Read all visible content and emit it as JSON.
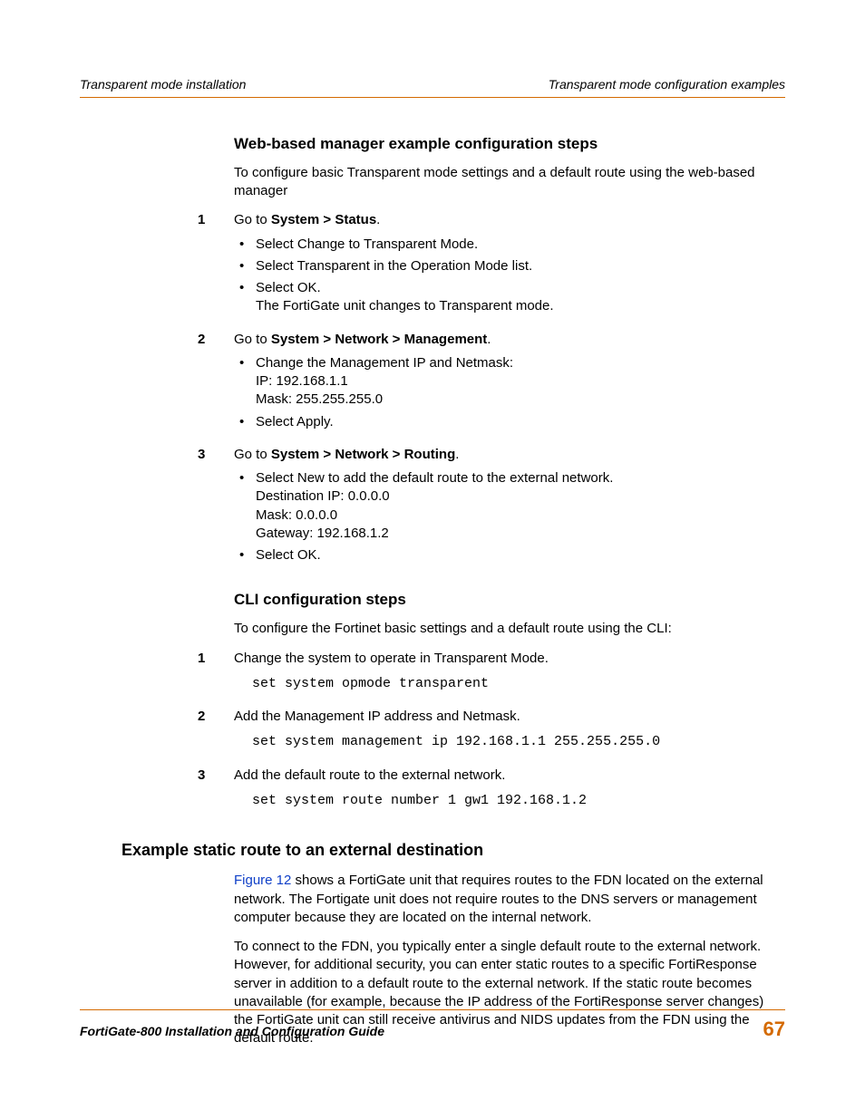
{
  "header": {
    "left": "Transparent mode installation",
    "right": "Transparent mode configuration examples"
  },
  "section1": {
    "heading": "Web-based manager example configuration steps",
    "intro": "To configure basic Transparent mode settings and a default route using the web-based manager",
    "steps": {
      "s1": {
        "num": "1",
        "lead": "Go to ",
        "bold": "System > Status",
        "tail": ".",
        "b1": "Select Change to Transparent Mode.",
        "b2": "Select Transparent in the Operation Mode list.",
        "b3a": "Select OK.",
        "b3b": "The FortiGate unit changes to Transparent mode."
      },
      "s2": {
        "num": "2",
        "lead": "Go to ",
        "bold": "System > Network > Management",
        "tail": ".",
        "b1a": "Change the Management IP and Netmask:",
        "b1b": "IP: 192.168.1.1",
        "b1c": "Mask: 255.255.255.0",
        "b2": "Select Apply."
      },
      "s3": {
        "num": "3",
        "lead": "Go to ",
        "bold": "System > Network > Routing",
        "tail": ".",
        "b1a": "Select New to add the default route to the external network.",
        "b1b": "Destination IP: 0.0.0.0",
        "b1c": "Mask: 0.0.0.0",
        "b1d": "Gateway: 192.168.1.2",
        "b2": "Select OK."
      }
    }
  },
  "section2": {
    "heading": "CLI configuration steps",
    "intro": "To configure the Fortinet basic settings and a default route using the CLI:",
    "steps": {
      "s1": {
        "num": "1",
        "text": "Change the system to operate in Transparent Mode.",
        "code": "set system opmode transparent"
      },
      "s2": {
        "num": "2",
        "text": "Add the Management IP address and Netmask.",
        "code": "set system management ip 192.168.1.1 255.255.255.0"
      },
      "s3": {
        "num": "3",
        "text": "Add the default route to the external network.",
        "code": "set system route number 1 gw1 192.168.1.2"
      }
    }
  },
  "section3": {
    "heading": "Example static route to an external destination",
    "p1_ref": "Figure 12",
    "p1_rest": " shows a FortiGate unit that requires routes to the FDN located on the external network. The Fortigate unit does not require routes to the DNS servers or management computer because they are located on the internal network.",
    "p2": "To connect to the FDN, you typically enter a single default route to the external network. However, for additional security, you can enter static routes to a specific FortiResponse server in addition to a default route to the external network. If the static route becomes unavailable (for example, because the IP address of the FortiResponse server changes) the FortiGate unit can still receive antivirus and NIDS updates from the FDN using the default route."
  },
  "footer": {
    "title": "FortiGate-800 Installation and Configuration Guide",
    "page": "67"
  }
}
